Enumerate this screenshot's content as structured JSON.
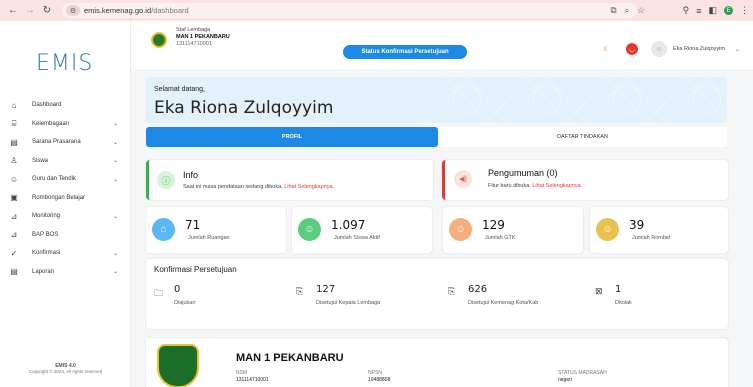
{
  "browser": {
    "url_domain": "emis.kemenag.go.id",
    "url_path": "/dashboard",
    "ext_label": "E"
  },
  "sidebar": {
    "logo": "EMIS",
    "items": [
      {
        "label": "Dashboard",
        "icon": "home-icon",
        "glyph": "⌂",
        "chevron": false
      },
      {
        "label": "Kelembagaan",
        "icon": "institution-icon",
        "glyph": "⌸",
        "chevron": true
      },
      {
        "label": "Sarana Prasarana",
        "icon": "building-icon",
        "glyph": "▤",
        "chevron": true
      },
      {
        "label": "Siswa",
        "icon": "user-icon",
        "glyph": "♙",
        "chevron": true
      },
      {
        "label": "Guru dan Tendik",
        "icon": "group-icon",
        "glyph": "☺",
        "chevron": true
      },
      {
        "label": "Rombongan Belajar",
        "icon": "clipboard-icon",
        "glyph": "▣",
        "chevron": false
      },
      {
        "label": "Monitoring",
        "icon": "chart-icon",
        "glyph": "⊿",
        "chevron": true
      },
      {
        "label": "BAP BOS",
        "icon": "chart-line-icon",
        "glyph": "⊿",
        "chevron": false
      },
      {
        "label": "Konfirmasi",
        "icon": "check-icon",
        "glyph": "✓",
        "chevron": true
      },
      {
        "label": "Laporan",
        "icon": "report-icon",
        "glyph": "▤",
        "chevron": true
      }
    ],
    "footer_title": "EMIS 4.0",
    "footer_copy": "Copyright © 2023, All rights reserved"
  },
  "header": {
    "staff_label": "Staf Lembaga",
    "school": "MAN 1 PEKANBARU",
    "nsm": "131114710001",
    "status_button": "Status Konfirmasi Persetujuan",
    "user": "Eka Riona Zulqoyyim"
  },
  "welcome": {
    "greeting": "Selamat datang,",
    "name": "Eka Riona Zulqoyyim"
  },
  "tabs": {
    "profil": "PROFIL",
    "daftar": "DAFTAR TINDAKAN"
  },
  "info": {
    "title": "Info",
    "desc": "Saat ini masa pendataan sedang dibuka. ",
    "link": "Lihat Selengkapnya."
  },
  "pengumuman": {
    "title": "Pengumuman (0)",
    "desc": "Fitur baru dibuka. ",
    "link": "Lihat Selengkapnya."
  },
  "stats": [
    {
      "value": "71",
      "label": "Jumlah Ruangan",
      "color": "#59b8f5",
      "icon": "room-icon"
    },
    {
      "value": "1.097",
      "label": "Jumlah Siswa Aktif",
      "color": "#5ccc7e",
      "icon": "students-icon"
    },
    {
      "value": "129",
      "label": "Jumlah GTK",
      "color": "#f6ae7c",
      "icon": "gtk-icon"
    },
    {
      "value": "39",
      "label": "Jumlah Rombel",
      "color": "#e8c24e",
      "icon": "rombel-icon"
    }
  ],
  "konfirmasi": {
    "title": "Konfirmasi Persetujuan",
    "items": [
      {
        "value": "0",
        "label": "Diajukan",
        "icon": "folder-icon"
      },
      {
        "value": "127",
        "label": "Disetujui Kepala Lembaga",
        "icon": "doc-check-icon"
      },
      {
        "value": "626",
        "label": "Disetujui Kemenag Kota/Kab",
        "icon": "doc-check-icon"
      },
      {
        "value": "1",
        "label": "Ditolak",
        "icon": "doc-reject-icon"
      }
    ]
  },
  "school_card": {
    "name": "MAN 1 PEKANBARU",
    "nsm_label": "NSM",
    "nsm_value": "131114710001",
    "npsn_label": "NPSN",
    "npsn_value": "10488808",
    "status_label": "STATUS MADRASAH",
    "status_value": "negeri"
  }
}
